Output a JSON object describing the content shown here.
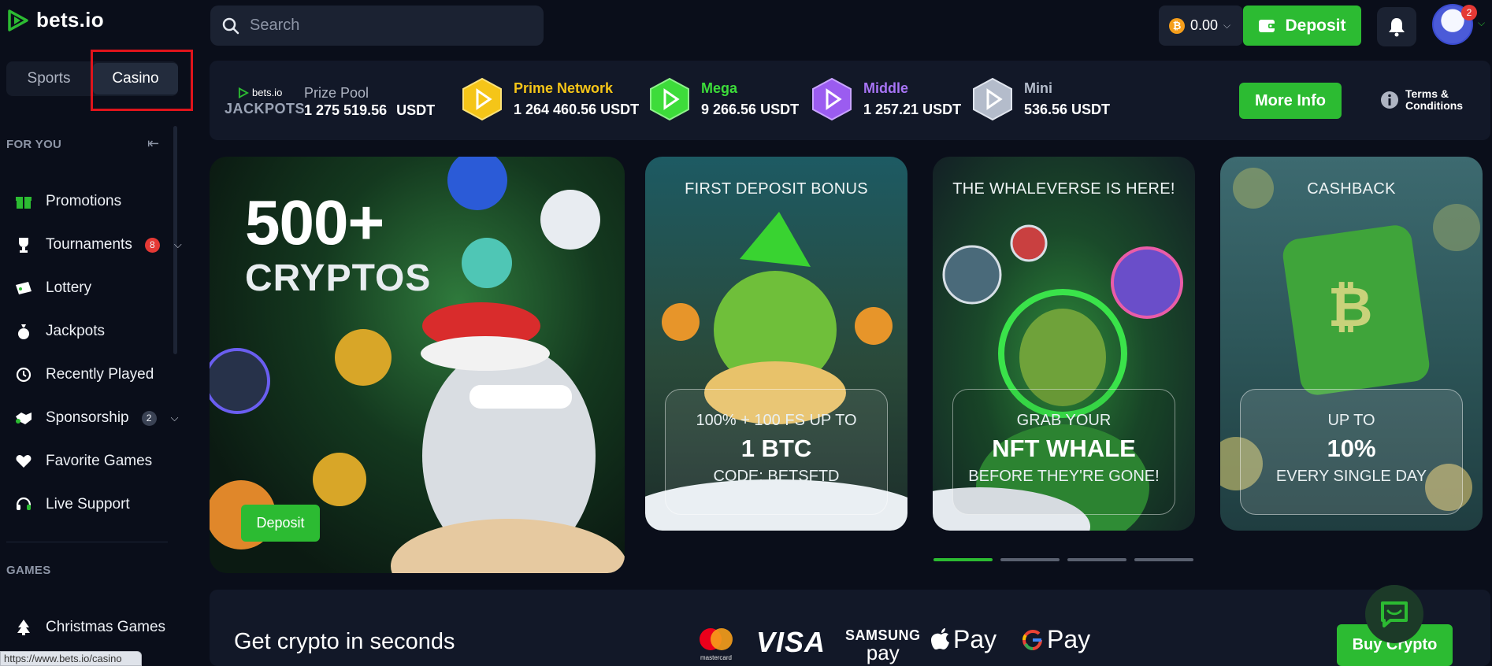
{
  "brand": {
    "logo_text": "bets.io"
  },
  "header": {
    "search_placeholder": "Search",
    "balance": "0.00",
    "currency_symbol": "₿",
    "deposit_label": "Deposit",
    "notification_count": "2"
  },
  "sidebar": {
    "segments": [
      {
        "label": "Sports"
      },
      {
        "label": "Casino",
        "selected": true
      }
    ],
    "section_for_you": "FOR YOU",
    "items": [
      {
        "label": "Promotions",
        "icon": "gift-icon"
      },
      {
        "label": "Tournaments",
        "icon": "trophy-icon",
        "badge": "8",
        "badge_color": "#e53935"
      },
      {
        "label": "Lottery",
        "icon": "ticket-icon"
      },
      {
        "label": "Jackpots",
        "icon": "money-bag-icon"
      },
      {
        "label": "Recently Played",
        "icon": "history-icon"
      },
      {
        "label": "Sponsorship",
        "icon": "handshake-icon",
        "badge": "2",
        "badge_color": "#3a4254"
      },
      {
        "label": "Favorite Games",
        "icon": "heart-icon"
      },
      {
        "label": "Live Support",
        "icon": "headset-icon"
      }
    ],
    "section_games": "GAMES",
    "games_items": [
      {
        "label": "Christmas Games",
        "icon": "christmas-tree-icon"
      }
    ]
  },
  "jackpots": {
    "brand_small": "bets.io",
    "brand_label": "JACKPOTS",
    "prize_pool_label": "Prize Pool",
    "prize_pool_value": "1 275 519.56",
    "prize_pool_unit": "USDT",
    "tiers": [
      {
        "name": "Prime Network",
        "value": "1 264 460.56 USDT",
        "color": "#f5c518"
      },
      {
        "name": "Mega",
        "value": "9 266.56 USDT",
        "color": "#3ddc3a"
      },
      {
        "name": "Middle",
        "value": "1 257.21 USDT",
        "color": "#9b5cf0"
      },
      {
        "name": "Mini",
        "value": "536.56 USDT",
        "color": "#b4bccb"
      }
    ],
    "more_info_label": "More Info",
    "terms_line1": "Terms &",
    "terms_line2": "Conditions"
  },
  "promos": {
    "hero": {
      "big": "500+",
      "sub": "CRYPTOS",
      "button": "Deposit"
    },
    "cards": [
      {
        "title": "FIRST DEPOSIT BONUS",
        "line1": "100% + 100 FS UP TO",
        "line2": "1 BTC",
        "line3": "CODE: BETSFTD"
      },
      {
        "title": "THE WHALEVERSE IS HERE!",
        "line1": "GRAB YOUR",
        "line2": "NFT WHALE",
        "line3": "BEFORE THEY'RE GONE!"
      },
      {
        "title": "CASHBACK",
        "line1": "UP TO",
        "line2": "10%",
        "line3": "EVERY SINGLE DAY"
      }
    ],
    "active_page": 1,
    "page_count": 4
  },
  "crypto": {
    "title": "Get crypto in seconds",
    "payment_logos": [
      "mastercard",
      "VISA",
      "SAMSUNG pay",
      "Apple Pay",
      "G Pay"
    ],
    "mastercard_label": "mastercard",
    "visa": "VISA",
    "samsung_top": "SAMSUNG",
    "samsung_bottom": "pay",
    "apple_pay": "Pay",
    "google_pay": "Pay",
    "buy_label": "Buy Crypto"
  },
  "status_url": "https://www.bets.io/casino",
  "colors": {
    "accent": "#2cbb32",
    "background": "#0a0e1a",
    "panel": "#121828",
    "highlight_box": "#e0141b"
  }
}
